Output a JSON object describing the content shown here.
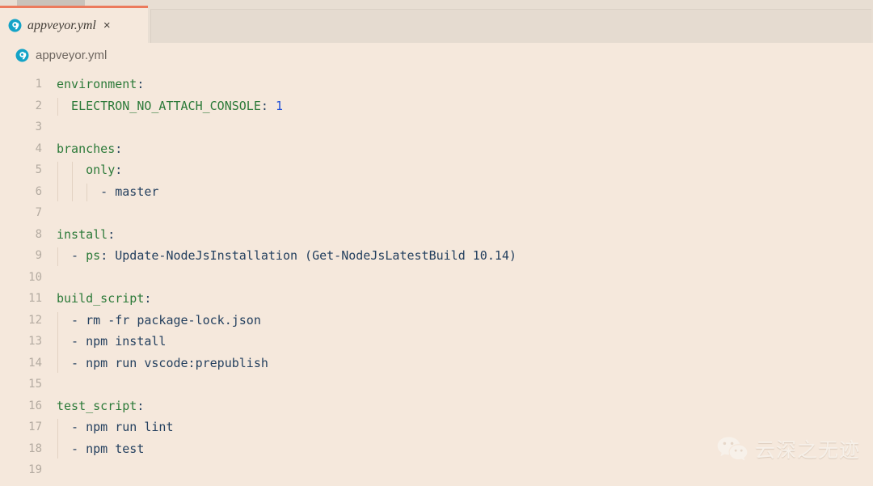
{
  "window": {
    "accent_color": "#ec7a5c",
    "editor_background": "#f5e8dc",
    "tabbar_background": "#e8ded3"
  },
  "tabbar": {
    "tabs": [
      {
        "label": "appveyor.yml",
        "icon": "appveyor-file-icon",
        "close_label": "×",
        "active": true
      }
    ]
  },
  "breadcrumb": {
    "icon": "appveyor-file-icon",
    "label": "appveyor.yml"
  },
  "editor": {
    "language": "yaml",
    "lines": [
      {
        "number": "1",
        "tokens": [
          {
            "text": "environment",
            "type": "key"
          },
          {
            "text": ":",
            "type": "punct"
          }
        ]
      },
      {
        "number": "2",
        "tokens": [
          {
            "text": "  ELECTRON_NO_ATTACH_CONSOLE",
            "type": "key"
          },
          {
            "text": ": ",
            "type": "punct"
          },
          {
            "text": "1",
            "type": "num"
          }
        ]
      },
      {
        "number": "3",
        "tokens": []
      },
      {
        "number": "4",
        "tokens": [
          {
            "text": "branches",
            "type": "key"
          },
          {
            "text": ":",
            "type": "punct"
          }
        ]
      },
      {
        "number": "5",
        "tokens": [
          {
            "text": "    only",
            "type": "key"
          },
          {
            "text": ":",
            "type": "punct"
          }
        ]
      },
      {
        "number": "6",
        "tokens": [
          {
            "text": "      - master",
            "type": "plain"
          }
        ]
      },
      {
        "number": "7",
        "tokens": []
      },
      {
        "number": "8",
        "tokens": [
          {
            "text": "install",
            "type": "key"
          },
          {
            "text": ":",
            "type": "punct"
          }
        ]
      },
      {
        "number": "9",
        "tokens": [
          {
            "text": "  - ",
            "type": "plain"
          },
          {
            "text": "ps",
            "type": "key"
          },
          {
            "text": ": Update-NodeJsInstallation (Get-NodeJsLatestBuild 10.14)",
            "type": "plain"
          }
        ]
      },
      {
        "number": "10",
        "tokens": []
      },
      {
        "number": "11",
        "tokens": [
          {
            "text": "build_script",
            "type": "key"
          },
          {
            "text": ":",
            "type": "punct"
          }
        ]
      },
      {
        "number": "12",
        "tokens": [
          {
            "text": "  - rm -fr package-lock.json",
            "type": "plain"
          }
        ]
      },
      {
        "number": "13",
        "tokens": [
          {
            "text": "  - npm install",
            "type": "plain"
          }
        ]
      },
      {
        "number": "14",
        "tokens": [
          {
            "text": "  - npm run vscode:prepublish",
            "type": "plain"
          }
        ]
      },
      {
        "number": "15",
        "tokens": []
      },
      {
        "number": "16",
        "tokens": [
          {
            "text": "test_script",
            "type": "key"
          },
          {
            "text": ":",
            "type": "punct"
          }
        ]
      },
      {
        "number": "17",
        "tokens": [
          {
            "text": "  - npm run lint",
            "type": "plain"
          }
        ]
      },
      {
        "number": "18",
        "tokens": [
          {
            "text": "  - npm test",
            "type": "plain"
          }
        ]
      },
      {
        "number": "19",
        "tokens": []
      }
    ],
    "indent_guides": [
      {
        "line_start": 2,
        "line_end": 2,
        "level": 1
      },
      {
        "line_start": 5,
        "line_end": 6,
        "level": 1
      },
      {
        "line_start": 5,
        "line_end": 6,
        "level": 2
      },
      {
        "line_start": 6,
        "line_end": 6,
        "level": 3
      },
      {
        "line_start": 9,
        "line_end": 9,
        "level": 1
      },
      {
        "line_start": 12,
        "line_end": 14,
        "level": 1
      },
      {
        "line_start": 17,
        "line_end": 18,
        "level": 1
      }
    ]
  },
  "watermark": {
    "text": "云深之无迹",
    "logo": "wechat-logo"
  }
}
